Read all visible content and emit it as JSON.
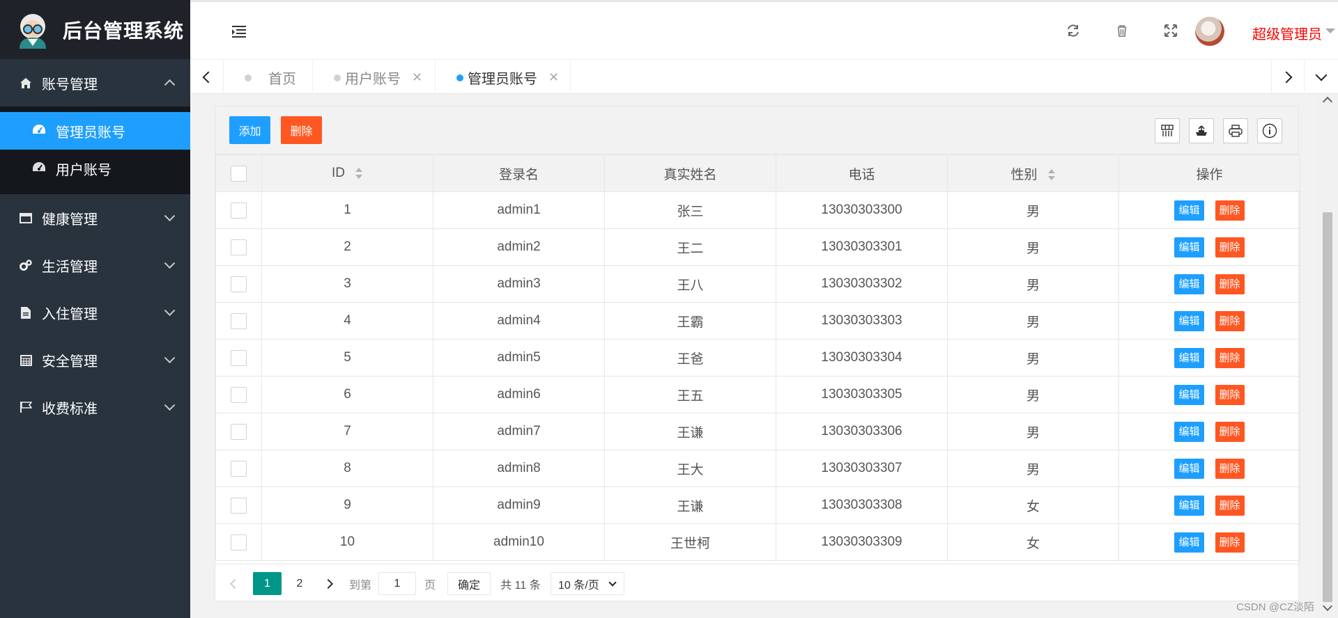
{
  "app": {
    "title": "后台管理系统"
  },
  "sidebar": {
    "items": [
      {
        "label": "账号管理",
        "icon": "home-icon",
        "expanded": true,
        "children": [
          {
            "label": "管理员账号",
            "icon": "dashboard-icon",
            "active": true
          },
          {
            "label": "用户账号",
            "icon": "dashboard-icon",
            "active": false
          }
        ]
      },
      {
        "label": "健康管理",
        "icon": "window-icon"
      },
      {
        "label": "生活管理",
        "icon": "gears-icon"
      },
      {
        "label": "入住管理",
        "icon": "file-icon"
      },
      {
        "label": "安全管理",
        "icon": "calendar-icon"
      },
      {
        "label": "收费标准",
        "icon": "flag-icon"
      }
    ]
  },
  "header": {
    "user_name": "超级管理员",
    "icons": [
      "refresh-icon",
      "trash-icon",
      "fullscreen-icon"
    ]
  },
  "tabs": [
    {
      "label": "首页",
      "closable": false,
      "active": false
    },
    {
      "label": "用户账号",
      "closable": true,
      "active": false
    },
    {
      "label": "管理员账号",
      "closable": true,
      "active": true
    }
  ],
  "toolbar": {
    "add_label": "添加",
    "delete_label": "删除"
  },
  "table": {
    "columns": [
      "ID",
      "登录名",
      "真实姓名",
      "电话",
      "性别",
      "操作"
    ],
    "edit_label": "编辑",
    "delete_label": "删除",
    "rows": [
      {
        "id": "1",
        "login": "admin1",
        "name": "张三",
        "phone": "13030303300",
        "gender": "男"
      },
      {
        "id": "2",
        "login": "admin2",
        "name": "王二",
        "phone": "13030303301",
        "gender": "男"
      },
      {
        "id": "3",
        "login": "admin3",
        "name": "王八",
        "phone": "13030303302",
        "gender": "男"
      },
      {
        "id": "4",
        "login": "admin4",
        "name": "王霸",
        "phone": "13030303303",
        "gender": "男"
      },
      {
        "id": "5",
        "login": "admin5",
        "name": "王爸",
        "phone": "13030303304",
        "gender": "男"
      },
      {
        "id": "6",
        "login": "admin6",
        "name": "王五",
        "phone": "13030303305",
        "gender": "男"
      },
      {
        "id": "7",
        "login": "admin7",
        "name": "王谦",
        "phone": "13030303306",
        "gender": "男"
      },
      {
        "id": "8",
        "login": "admin8",
        "name": "王大",
        "phone": "13030303307",
        "gender": "男"
      },
      {
        "id": "9",
        "login": "admin9",
        "name": "王谦",
        "phone": "13030303308",
        "gender": "女"
      },
      {
        "id": "10",
        "login": "admin10",
        "name": "王世柯",
        "phone": "13030303309",
        "gender": "女"
      }
    ]
  },
  "pager": {
    "pages": [
      "1",
      "2"
    ],
    "current": "1",
    "goto_label": "到第",
    "goto_value": "1",
    "page_unit": "页",
    "confirm_label": "确定",
    "total_label": "共 11 条",
    "page_size": "10 条/页"
  },
  "watermark": "CSDN @CZ淡陌"
}
